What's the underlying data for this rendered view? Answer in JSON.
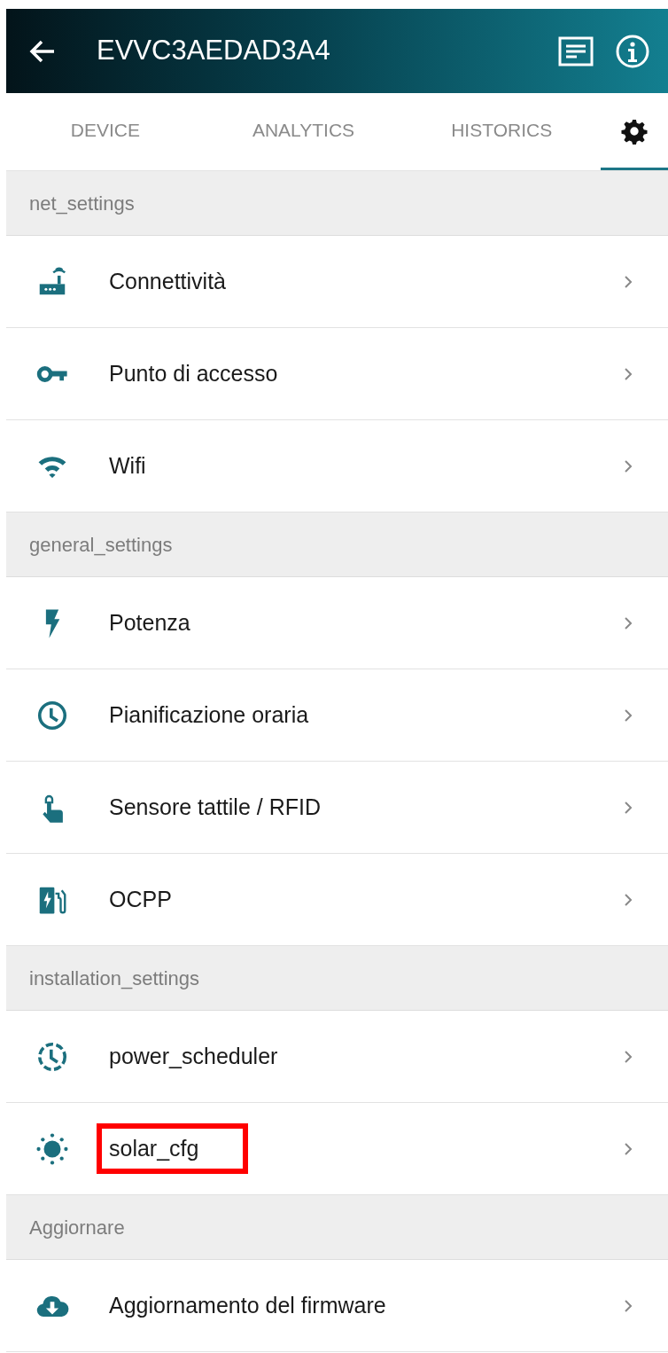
{
  "app_bar": {
    "title": "EVVC3AEDAD3A4"
  },
  "tabs": [
    {
      "kind": "text",
      "label": "DEVICE",
      "selected": false
    },
    {
      "kind": "text",
      "label": "ANALYTICS",
      "selected": false
    },
    {
      "kind": "text",
      "label": "HISTORICS",
      "selected": false
    },
    {
      "kind": "gear",
      "selected": true
    }
  ],
  "sections": [
    {
      "title": "net_settings",
      "items": [
        {
          "kind": "router",
          "label": "Connettività",
          "highlighted": false
        },
        {
          "kind": "key",
          "label": "Punto di accesso",
          "highlighted": false
        },
        {
          "kind": "wifi",
          "label": "Wifi",
          "highlighted": false
        }
      ]
    },
    {
      "title": "general_settings",
      "items": [
        {
          "kind": "bolt",
          "label": "Potenza",
          "highlighted": false
        },
        {
          "kind": "clock",
          "label": "Pianificazione oraria",
          "highlighted": false
        },
        {
          "kind": "touch",
          "label": "Sensore tattile / RFID",
          "highlighted": false
        },
        {
          "kind": "charger",
          "label": "OCPP",
          "highlighted": false
        }
      ]
    },
    {
      "title": "installation_settings",
      "items": [
        {
          "kind": "clock-dashed",
          "label": "power_scheduler",
          "highlighted": false
        },
        {
          "kind": "sun",
          "label": "solar_cfg",
          "highlighted": true
        }
      ]
    },
    {
      "title": "Aggiornare",
      "items": [
        {
          "kind": "cloud",
          "label": "Aggiornamento del firmware",
          "highlighted": false
        }
      ]
    }
  ]
}
